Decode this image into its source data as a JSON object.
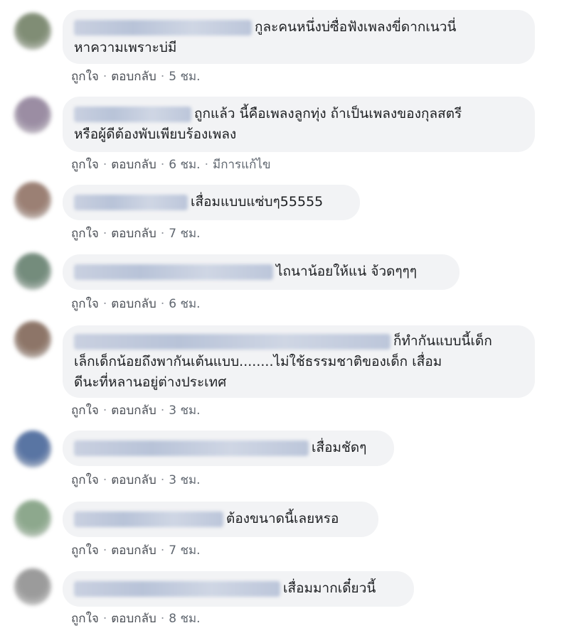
{
  "comments": [
    {
      "text": "กูละคนหนึ่งบ่ซื่อฟังเพลงขี่ดากเนวนี่\nหาความเพราะบ่มี",
      "like": "ถูกใจ",
      "reply": "ตอบกลับ",
      "time": "5 ชม.",
      "edited": "",
      "avatar_color": "#6b7a5e"
    },
    {
      "text": "ถูกแล้ว นี้คือเพลงลูกทุ่ง ถ้าเป็นเพลงของกุลสตรี\nหรือผู้ดีต้องพับเพียบร้องเพลง",
      "like": "ถูกใจ",
      "reply": "ตอบกลับ",
      "time": "6 ชม.",
      "edited": "มีการแก้ไข",
      "avatar_color": "#8a7a94"
    },
    {
      "text": "เสื่อมแบบแซ่บๆ55555",
      "like": "ถูกใจ",
      "reply": "ตอบกลับ",
      "time": "7 ชม.",
      "edited": "",
      "avatar_color": "#8a6a5c"
    },
    {
      "text": "ไถนาน้อยให้แน่ จ้วดๆๆๆ",
      "like": "ถูกใจ",
      "reply": "ตอบกลับ",
      "time": "6 ชม.",
      "edited": "",
      "avatar_color": "#5c7866"
    },
    {
      "text": "ก็ทำกันแบบนี้เด็ก\nเล็กเด็กน้อยถึงพากันเต้นแบบ........ไม่ใช้ธรรมชาติของเด็ก เสื่อม\nดีนะที่หลานอยู่ต่างประเทศ",
      "like": "ถูกใจ",
      "reply": "ตอบกลับ",
      "time": "3 ชม.",
      "edited": "",
      "avatar_color": "#7a5e4e"
    },
    {
      "text": "เสื่อมชัดๆ",
      "like": "ถูกใจ",
      "reply": "ตอบกลับ",
      "time": "3 ชม.",
      "edited": "",
      "avatar_color": "#3d5d94"
    },
    {
      "text": "ต้องขนาดนี้เลยหรอ",
      "like": "ถูกใจ",
      "reply": "ตอบกลับ",
      "time": "7 ชม.",
      "edited": "",
      "avatar_color": "#7a9a7a"
    },
    {
      "text": "เสื่อมมากเดี๋ยวนี้",
      "like": "ถูกใจ",
      "reply": "ตอบกลับ",
      "time": "8 ชม.",
      "edited": "",
      "avatar_color": "#8a8a8a"
    }
  ],
  "colors": {
    "bubble_bg": "#f2f3f5",
    "action_text": "#606770"
  }
}
